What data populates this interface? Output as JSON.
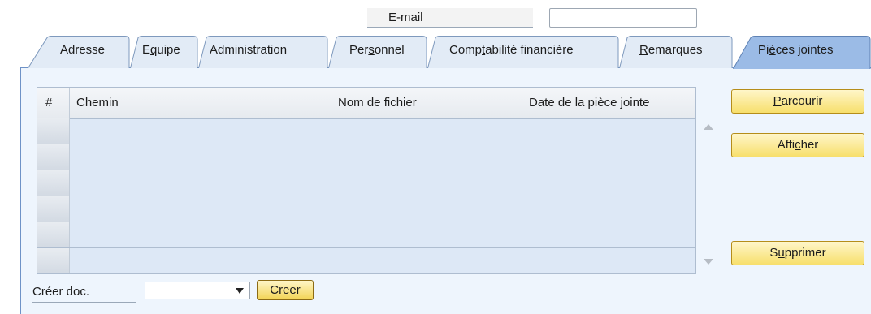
{
  "email": {
    "label": "E-mail",
    "value": ""
  },
  "tabs": [
    {
      "pre": "Adresse",
      "u": "",
      "post": "",
      "active": false
    },
    {
      "pre": "E",
      "u": "q",
      "post": "uipe",
      "active": false
    },
    {
      "pre": "Administration",
      "u": "",
      "post": "",
      "active": false
    },
    {
      "pre": "Per",
      "u": "s",
      "post": "onnel",
      "active": false
    },
    {
      "pre": "Comp",
      "u": "t",
      "post": "abilité financière",
      "active": false
    },
    {
      "pre": "",
      "u": "R",
      "post": "emarques",
      "active": false
    },
    {
      "pre": "Pi",
      "u": "è",
      "post": "ces jointes",
      "active": true
    }
  ],
  "grid": {
    "columns": [
      "#",
      "Chemin",
      "Nom de fichier",
      "Date de la pièce jointe"
    ],
    "rows": [
      [
        "",
        "",
        "",
        ""
      ],
      [
        "",
        "",
        "",
        ""
      ],
      [
        "",
        "",
        "",
        ""
      ],
      [
        "",
        "",
        "",
        ""
      ],
      [
        "",
        "",
        "",
        ""
      ],
      [
        "",
        "",
        "",
        ""
      ]
    ]
  },
  "buttons": {
    "browse": {
      "pre": "",
      "u": "P",
      "post": "arcourir"
    },
    "display": {
      "pre": "Affi",
      "u": "c",
      "post": "her"
    },
    "delete": {
      "pre": "S",
      "u": "u",
      "post": "pprimer"
    }
  },
  "create": {
    "label": "Créer doc.",
    "selected": "",
    "button": "Creer"
  },
  "colors": {
    "panel": "#eef5fd",
    "tab_active": "#9bbbe6",
    "tab_inactive": "#e2ebf6",
    "button": "#f7df6c"
  }
}
